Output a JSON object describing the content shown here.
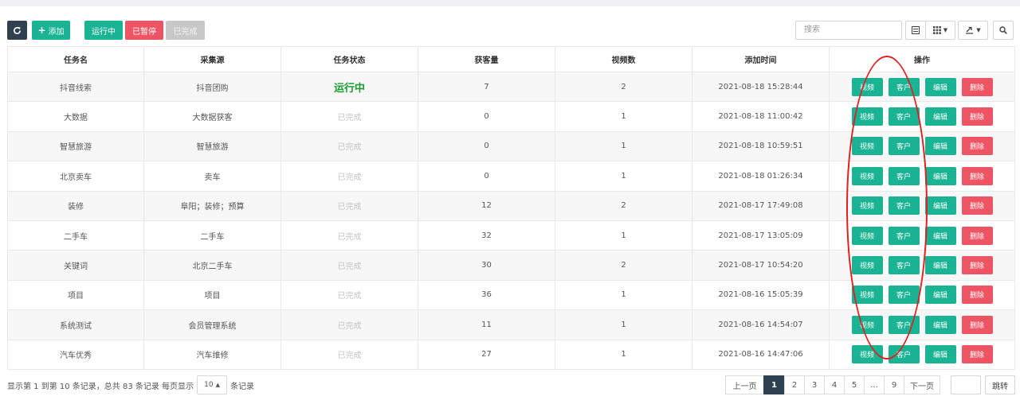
{
  "toolbar": {
    "refresh_icon": "refresh-icon",
    "add_label": "添加",
    "running_label": "运行中",
    "paused_label": "已暂停",
    "done_label": "已完成",
    "search_placeholder": "搜索",
    "list_icon": "list-view-icon",
    "grid_icon": "grid-columns-icon",
    "export_icon": "export-icon",
    "search_icon": "search-icon"
  },
  "table": {
    "headers": [
      "任务名",
      "采集源",
      "任务状态",
      "获客量",
      "视频数",
      "添加时间",
      "操作"
    ],
    "action_labels": {
      "video": "视频",
      "customer": "客户",
      "edit": "编辑",
      "delete": "删除"
    },
    "rows": [
      {
        "name": "抖音线索",
        "source": "抖音团购",
        "status": "运行中",
        "customers": "7",
        "videos": "2",
        "time": "2021-08-18 15:28:44"
      },
      {
        "name": "大数据",
        "source": "大数据获客",
        "status": "已完成",
        "customers": "0",
        "videos": "1",
        "time": "2021-08-18 11:00:42"
      },
      {
        "name": "智慧旅游",
        "source": "智慧旅游",
        "status": "已完成",
        "customers": "0",
        "videos": "1",
        "time": "2021-08-18 10:59:51"
      },
      {
        "name": "北京卖车",
        "source": "卖车",
        "status": "已完成",
        "customers": "0",
        "videos": "1",
        "time": "2021-08-18 01:26:34"
      },
      {
        "name": "装修",
        "source": "阜阳；装修；预算",
        "status": "已完成",
        "customers": "12",
        "videos": "2",
        "time": "2021-08-17 17:49:08"
      },
      {
        "name": "二手车",
        "source": "二手车",
        "status": "已完成",
        "customers": "32",
        "videos": "1",
        "time": "2021-08-17 13:05:09"
      },
      {
        "name": "关键词",
        "source": "北京二手车",
        "status": "已完成",
        "customers": "30",
        "videos": "2",
        "time": "2021-08-17 10:54:20"
      },
      {
        "name": "项目",
        "source": "项目",
        "status": "已完成",
        "customers": "36",
        "videos": "1",
        "time": "2021-08-16 15:05:39"
      },
      {
        "name": "系统测试",
        "source": "会员管理系统",
        "status": "已完成",
        "customers": "11",
        "videos": "1",
        "time": "2021-08-16 14:54:07"
      },
      {
        "name": "汽车优秀",
        "source": "汽车维修",
        "status": "已完成",
        "customers": "27",
        "videos": "1",
        "time": "2021-08-16 14:47:06"
      }
    ]
  },
  "footer": {
    "info_prefix": "显示第 1 到第 10 条记录，总共 83 条记录 每页显示",
    "page_size": "10",
    "info_suffix": "条记录"
  },
  "pagination": {
    "prev": "上一页",
    "pages": [
      "1",
      "2",
      "3",
      "4",
      "5",
      "...",
      "9"
    ],
    "active_page": "1",
    "next": "下一页",
    "jump": "跳转"
  },
  "colors": {
    "accent": "#1ab394",
    "danger": "#ed5565",
    "dark": "#2f4050",
    "running": "#1a9b2f",
    "annotation": "#e02020"
  }
}
